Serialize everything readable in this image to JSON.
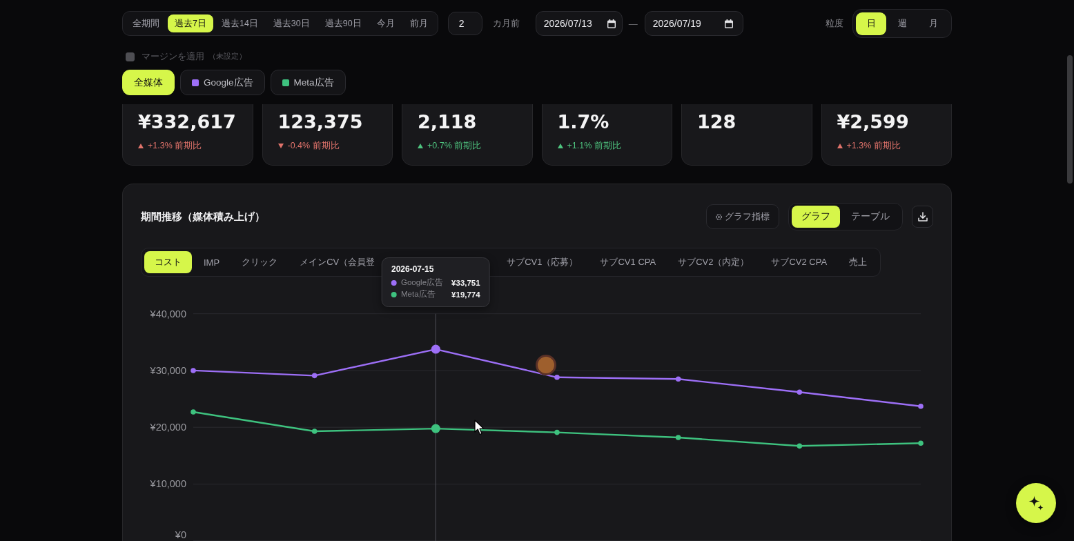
{
  "filters": {
    "periods": [
      {
        "label": "全期間",
        "selected": false
      },
      {
        "label": "過去7日",
        "selected": true
      },
      {
        "label": "過去14日",
        "selected": false
      },
      {
        "label": "過去30日",
        "selected": false
      },
      {
        "label": "過去90日",
        "selected": false
      },
      {
        "label": "今月",
        "selected": false
      },
      {
        "label": "前月",
        "selected": false
      }
    ],
    "month_offset": {
      "value": "2",
      "unit": "カ月前"
    },
    "date_range": {
      "start": "2026/07/13",
      "separator": "—",
      "end": "2026/07/19"
    },
    "granularity": {
      "label": "粒度",
      "options": [
        {
          "label": "日",
          "selected": true
        },
        {
          "label": "週",
          "selected": false
        },
        {
          "label": "月",
          "selected": false
        }
      ]
    },
    "margin": {
      "label": "マージンを適用",
      "note": "（未設定）",
      "checked": false,
      "disabled": true
    },
    "media": [
      {
        "label": "全媒体",
        "selected": true
      },
      {
        "label": "Google広告",
        "selected": false,
        "color": "#9d6ff7"
      },
      {
        "label": "Meta広告",
        "selected": false,
        "color": "#3ec27f"
      }
    ]
  },
  "kpis": [
    {
      "value": "¥332,617",
      "up": true,
      "favorable": false,
      "change": "+1.3% 前期比"
    },
    {
      "value": "123,375",
      "up": false,
      "favorable": false,
      "change": "-0.4% 前期比"
    },
    {
      "value": "2,118",
      "up": true,
      "favorable": true,
      "change": "+0.7% 前期比"
    },
    {
      "value": "1.7%",
      "up": true,
      "favorable": true,
      "change": "+1.1% 前期比"
    },
    {
      "value": "128"
    },
    {
      "value": "¥2,599",
      "up": true,
      "favorable": false,
      "change": "+1.3% 前期比"
    }
  ],
  "trend_panel": {
    "title": "期間推移（媒体積み上げ）",
    "metrics_button": "グラフ指標",
    "views": [
      {
        "label": "グラフ",
        "selected": true
      },
      {
        "label": "テーブル",
        "selected": false
      }
    ],
    "metric_tabs": [
      {
        "label": "コスト",
        "selected": true,
        "occluded": false
      },
      {
        "label": "IMP",
        "selected": false,
        "occluded": false
      },
      {
        "label": "クリック",
        "selected": false,
        "occluded": false
      },
      {
        "label": "メインCV（会員登",
        "selected": false,
        "occluded": true
      },
      {
        "label": "サブCV1（応募）",
        "selected": false,
        "occluded": false
      },
      {
        "label": "サブCV1 CPA",
        "selected": false,
        "occluded": false
      },
      {
        "label": "サブCV2（内定）",
        "selected": false,
        "occluded": false
      },
      {
        "label": "サブCV2 CPA",
        "selected": false,
        "occluded": false
      },
      {
        "label": "売上",
        "selected": false,
        "occluded": false
      }
    ],
    "chart_data": {
      "type": "line",
      "grid": true,
      "ylim": [
        0,
        40000
      ],
      "yticks": [
        {
          "value": 0,
          "label": "¥0"
        },
        {
          "value": 10000,
          "label": "¥10,000"
        },
        {
          "value": 20000,
          "label": "¥20,000"
        },
        {
          "value": 30000,
          "label": "¥30,000"
        },
        {
          "value": 40000,
          "label": "¥40,000"
        }
      ],
      "series": [
        {
          "name": "Google広告",
          "color": "#9d6ff7",
          "marker": "circle",
          "values": [
            30000,
            29100,
            33751,
            28800,
            28500,
            26200,
            23700
          ]
        },
        {
          "name": "Meta広告",
          "color": "#3ec27f",
          "marker": "circle",
          "values": [
            22700,
            19300,
            19774,
            19100,
            18200,
            16700,
            17200
          ]
        }
      ]
    },
    "tooltip": {
      "title": "2026-07-15",
      "values": [
        "¥33,751",
        "¥19,774"
      ]
    }
  }
}
